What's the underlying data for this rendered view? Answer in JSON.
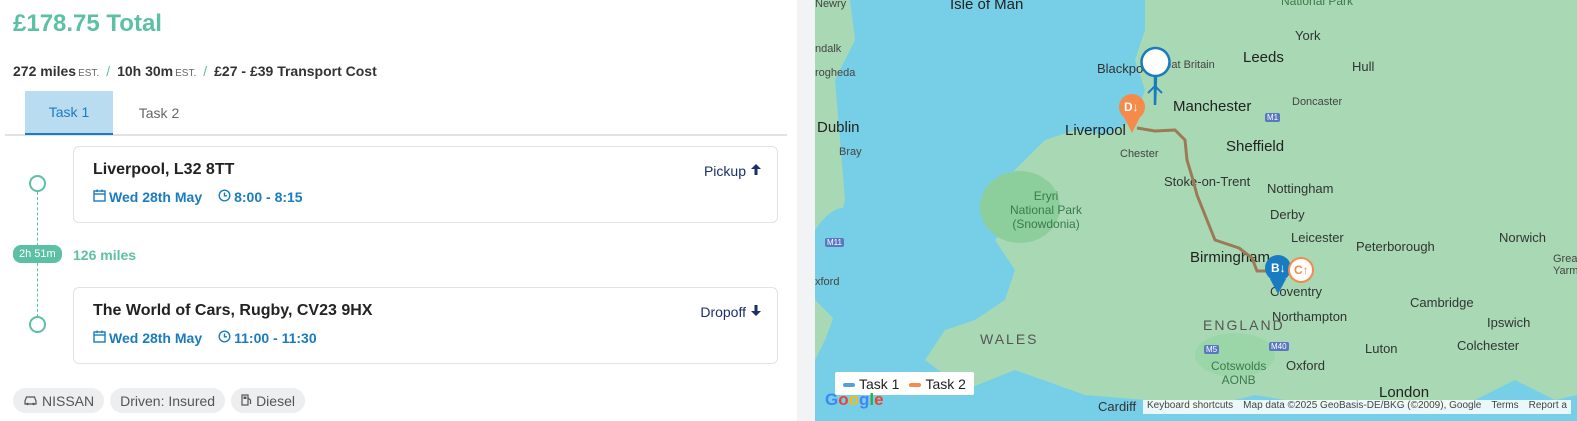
{
  "header": {
    "total": "£178.75 Total"
  },
  "summary": {
    "distance": "272 miles",
    "distance_est": "EST.",
    "duration": "10h 30m",
    "duration_est": "EST.",
    "transport_cost": "£27 - £39 Transport Cost"
  },
  "tabs": [
    {
      "label": "Task 1",
      "active": true
    },
    {
      "label": "Task 2",
      "active": false
    }
  ],
  "stops": [
    {
      "address": "Liverpool, L32 8TT",
      "date": "Wed 28th May",
      "time": "8:00 - 8:15",
      "action": "Pickup"
    },
    {
      "address": "The World of Cars, Rugby, CV23 9HX",
      "date": "Wed 28th May",
      "time": "11:00 - 11:30",
      "action": "Dropoff"
    }
  ],
  "leg": {
    "duration": "2h 51m",
    "distance": "126 miles"
  },
  "chips": [
    {
      "label": "NISSAN",
      "icon": "car-icon"
    },
    {
      "label": "Driven: Insured"
    },
    {
      "label": "Diesel",
      "icon": "fuel-icon"
    }
  ],
  "colors": {
    "accent": "#5cc0a4",
    "blue": "#1a7cc0",
    "navy": "#1b2f6b",
    "task1": "#4fa3d9",
    "task2": "#f58a4b"
  },
  "map": {
    "labels": {
      "isle_of_man": "Isle of Man",
      "newry": "Newry",
      "dundalk": "ndalk",
      "drogheda": "rogheda",
      "dublin": "Dublin",
      "bray": "Bray",
      "blackpool": "Blackpool",
      "great_britain": "Great Britain",
      "leeds": "Leeds",
      "york": "York",
      "hull": "Hull",
      "manchester": "Manchester",
      "doncaster": "Doncaster",
      "liverpool": "Liverpool",
      "chester": "Chester",
      "sheffield": "Sheffield",
      "stoke": "Stoke-on-Trent",
      "nottingham": "Nottingham",
      "derby": "Derby",
      "eryri_1": "Eryri",
      "eryri_2": "National Park",
      "eryri_3": "(Snowdonia)",
      "leicester": "Leicester",
      "peterborough": "Peterborough",
      "norwich": "Norwich",
      "birmingham": "Birmingham",
      "coventry": "Coventry",
      "great_yarmouth_1": "Grea",
      "great_yarmouth_2": "Yarmo",
      "wexford": "xford",
      "cambridge": "Cambridge",
      "northampton": "Northampton",
      "ipswich": "Ipswich",
      "wales": "WALES",
      "england": "ENGLAND",
      "luton": "Luton",
      "colchester": "Colchester",
      "cotswolds_1": "Cotswolds",
      "cotswolds_2": "AONB",
      "oxford": "Oxford",
      "london": "London",
      "cardiff": "Cardiff",
      "national_park_top": "National Park"
    },
    "roads": {
      "m1": "M1",
      "m11": "M11",
      "m5": "M5",
      "m40": "M40"
    },
    "markers": {
      "b": "B",
      "c": "C",
      "d": "D"
    },
    "legend": [
      {
        "label": "Task 1"
      },
      {
        "label": "Task 2"
      }
    ],
    "google": "Google",
    "attribution": {
      "shortcuts": "Keyboard shortcuts",
      "data": "Map data ©2025 GeoBasis-DE/BKG (©2009), Google",
      "terms": "Terms",
      "report": "Report a"
    }
  }
}
